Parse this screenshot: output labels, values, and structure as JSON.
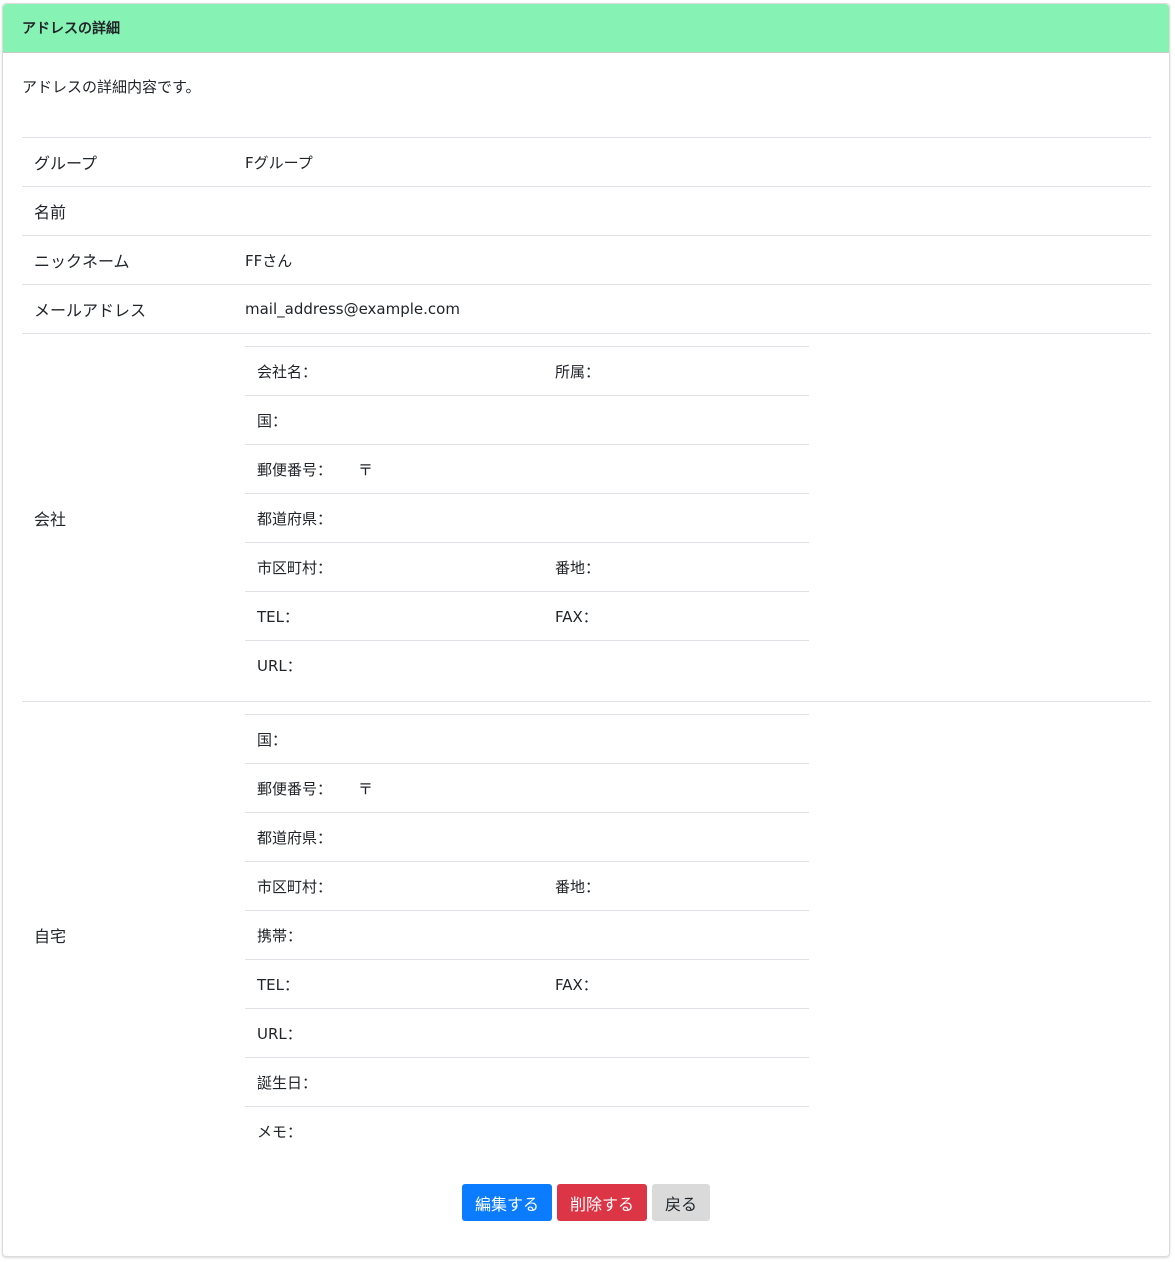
{
  "header": {
    "title": "アドレスの詳細"
  },
  "description": "アドレスの詳細内容です。",
  "rows": {
    "group": {
      "label": "グループ",
      "value": "Fグループ"
    },
    "name": {
      "label": "名前",
      "value": ""
    },
    "nickname": {
      "label": "ニックネーム",
      "value": "FFさん"
    },
    "email": {
      "label": "メールアドレス",
      "value": "mail_address@example.com"
    }
  },
  "company": {
    "label": "会社",
    "company_name": "会社名：",
    "department": "所属：",
    "country": "国：",
    "postal": "郵便番号：",
    "postal_mark": "〒",
    "prefecture": "都道府県：",
    "city": "市区町村：",
    "street": "番地：",
    "tel": "TEL：",
    "fax": "FAX：",
    "url": "URL："
  },
  "home": {
    "label": "自宅",
    "country": "国：",
    "postal": "郵便番号：",
    "postal_mark": "〒",
    "prefecture": "都道府県：",
    "city": "市区町村：",
    "street": "番地：",
    "mobile": "携帯：",
    "tel": "TEL：",
    "fax": "FAX：",
    "url": "URL：",
    "birthday": "誕生日：",
    "memo": "メモ："
  },
  "buttons": {
    "edit": "編集する",
    "delete": "削除する",
    "back": "戻る"
  },
  "colors": {
    "header_bg": "#86f2b4",
    "edit": "#0b7cff",
    "delete": "#dc3545",
    "back": "#dadada"
  }
}
